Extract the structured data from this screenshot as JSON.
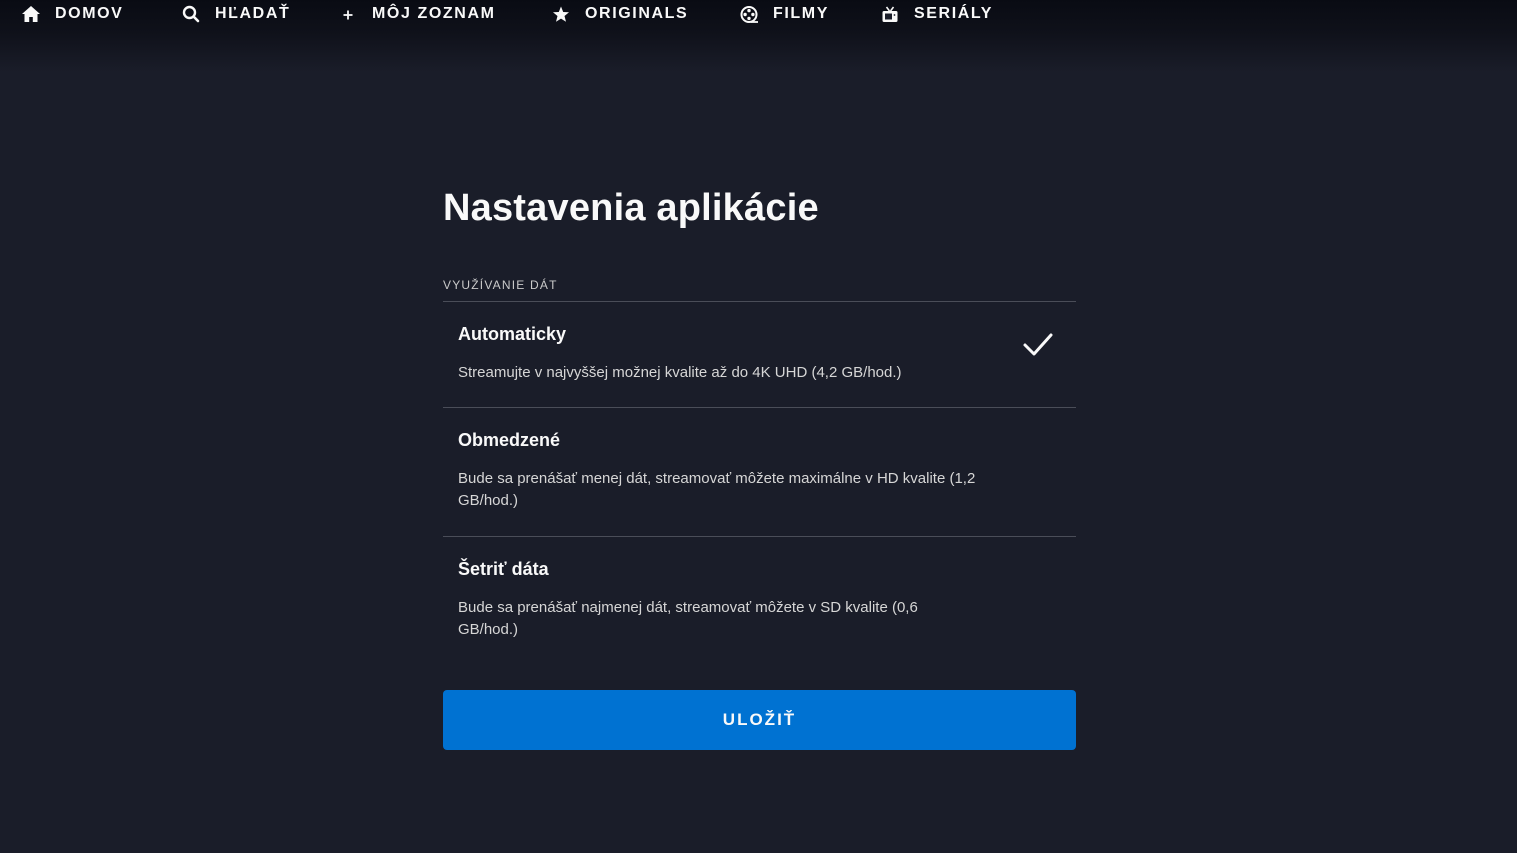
{
  "nav": {
    "items": [
      {
        "label": "DOMOV",
        "icon": "home-icon"
      },
      {
        "label": "HĽADAŤ",
        "icon": "search-icon"
      },
      {
        "label": "MÔJ ZOZNAM",
        "icon": "plus-icon"
      },
      {
        "label": "ORIGINALS",
        "icon": "star-icon"
      },
      {
        "label": "FILMY",
        "icon": "film-reel-icon"
      },
      {
        "label": "SERIÁLY",
        "icon": "tv-icon"
      }
    ]
  },
  "page": {
    "title": "Nastavenia aplikácie",
    "section_label": "VYUŽÍVANIE DÁT",
    "options": [
      {
        "title": "Automaticky",
        "description": "Streamujte v najvyššej možnej kvalite až do 4K UHD (4,2 GB/hod.)",
        "selected": true
      },
      {
        "title": "Obmedzené",
        "description": "Bude sa prenášať menej dát, streamovať môžete maximálne v HD kvalite (1,2 GB/hod.)",
        "selected": false
      },
      {
        "title": "Šetriť dáta",
        "description": "Bude sa prenášať najmenej dát, streamovať môžete v SD kvalite (0,6 GB/hod.)",
        "selected": false
      }
    ],
    "save_label": "ULOŽIŤ"
  },
  "colors": {
    "background": "#1a1d29",
    "accent": "#0072d2",
    "text": "#f9f9f9",
    "divider": "#4a4d58"
  }
}
